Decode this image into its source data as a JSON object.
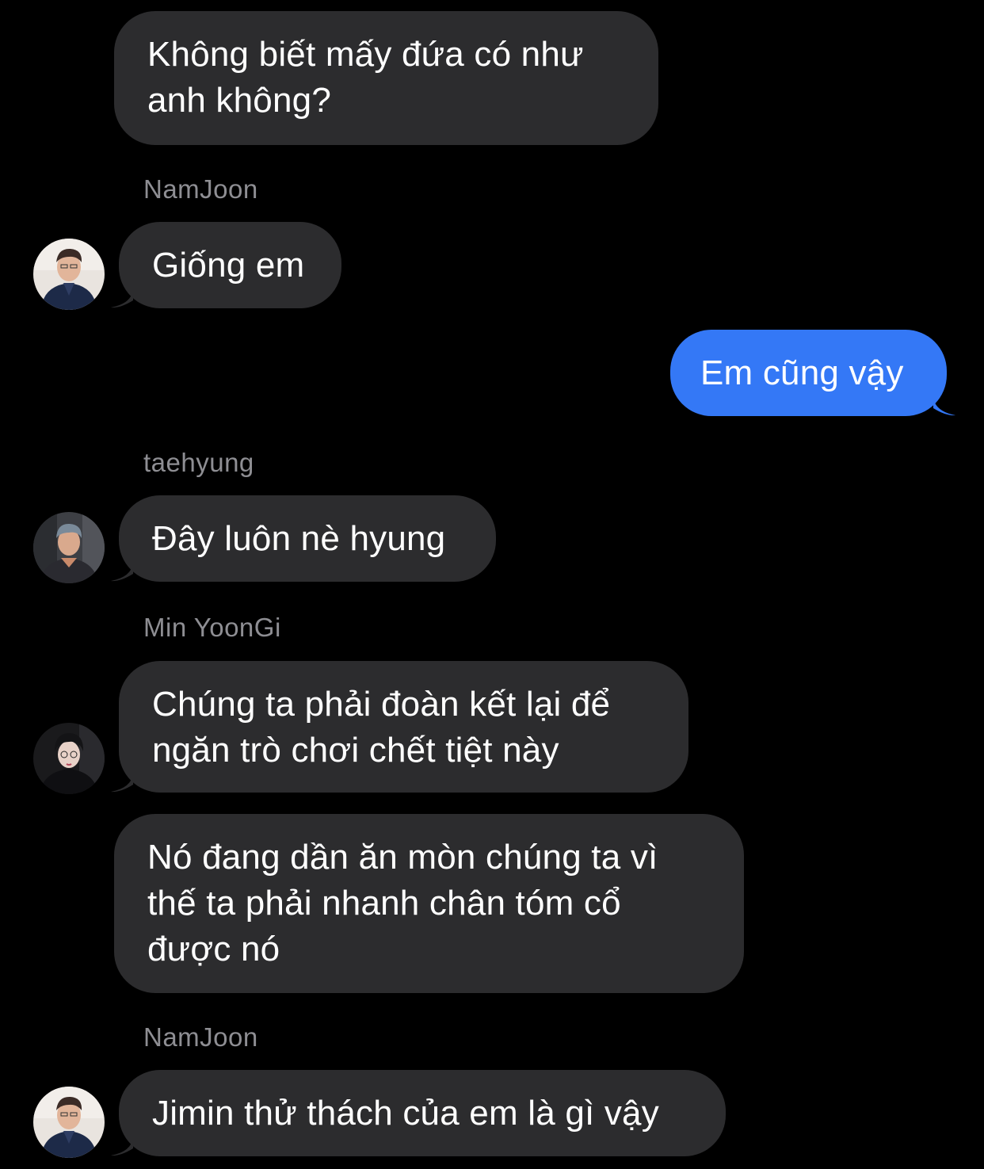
{
  "colors": {
    "background": "#000000",
    "incoming_bubble": "#2c2c2e",
    "outgoing_bubble": "#3478f6",
    "sender_name": "#8e8e93",
    "text": "#ffffff"
  },
  "messages": [
    {
      "direction": "incoming",
      "text": "Không biết mấy đứa có như\nanh không?"
    },
    {
      "direction": "incoming",
      "sender": "NamJoon",
      "avatar": "namjoon-avatar",
      "text": "Giống em"
    },
    {
      "direction": "outgoing",
      "text": "Em cũng vậy"
    },
    {
      "direction": "incoming",
      "sender": "taehyung",
      "avatar": "taehyung-avatar",
      "text": "Đây luôn nè hyung"
    },
    {
      "direction": "incoming",
      "sender": "Min YoonGi",
      "avatar": "yoongi-avatar",
      "text": "Chúng ta phải đoàn kết lại để\nngăn trò chơi chết tiệt này"
    },
    {
      "direction": "incoming",
      "text": "Nó đang dần ăn mòn chúng ta vì\nthế ta phải nhanh chân tóm cổ\nđược nó"
    },
    {
      "direction": "incoming",
      "sender": "NamJoon",
      "avatar": "namjoon-avatar",
      "text": "Jimin thử thách của em là gì vậy"
    }
  ]
}
